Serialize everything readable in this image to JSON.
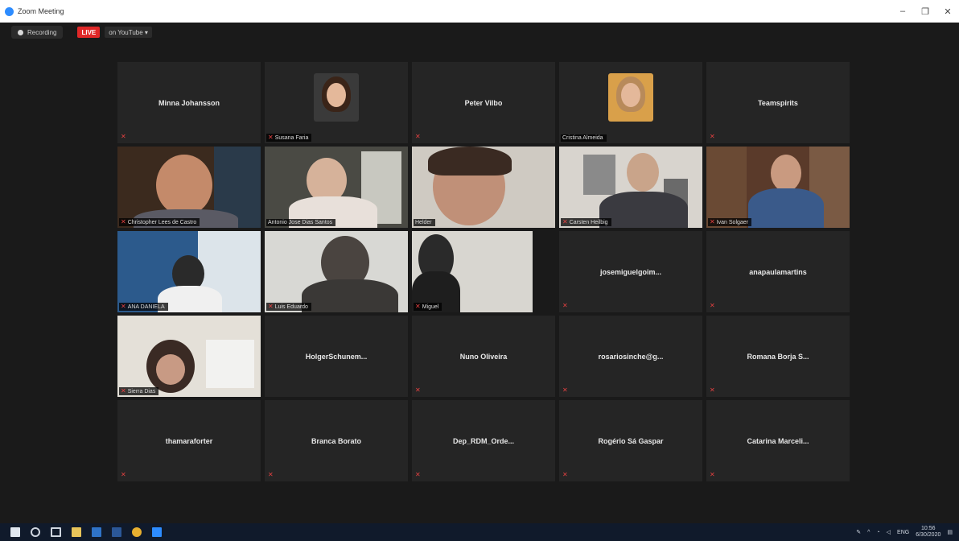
{
  "window": {
    "title": "Zoom Meeting",
    "controls": [
      "–",
      "❐",
      "✕"
    ]
  },
  "meeting_bar": {
    "recording_label": "Recording",
    "live_label": "LIVE",
    "live_on_label": "on YouTube ▾"
  },
  "row1": [
    {
      "kind": "name",
      "name": "Minna Johansson"
    },
    {
      "kind": "avatar",
      "label": "Susana Faria"
    },
    {
      "kind": "name",
      "name": "Peter Vilbo"
    },
    {
      "kind": "avatar",
      "label": "Cristina Almeida"
    },
    {
      "kind": "name",
      "name": "Teamspirits"
    }
  ],
  "row2_labels": [
    "Christopher Lees de Castro",
    "Antonio Jose Dias Santos",
    "Helder",
    "Carsten Heilbig",
    "Ivan Solgaer"
  ],
  "row3": {
    "video_labels": [
      "ANA DANIELA",
      "Luis Eduardo",
      "Miguel"
    ],
    "names": [
      "josemiguelgoim...",
      "anapaulamartins"
    ]
  },
  "row4": {
    "video_label": "Sierra Dias",
    "names": [
      "HolgerSchunem...",
      "Nuno Oliveira",
      "rosariosinche@g...",
      "Romana  Borja S..."
    ]
  },
  "row5": [
    "thamaraforter",
    "Branca Borato",
    "Dep_RDM_Orde...",
    "Rogério Sá Gaspar",
    "Catarina Marceli..."
  ],
  "taskbar": {
    "lang": "ENG",
    "time": "10:56",
    "date": "6/30/2020"
  },
  "colors": {
    "active_speaker": "#8ecf3a",
    "muted": "#e34040",
    "live": "#e02828"
  }
}
